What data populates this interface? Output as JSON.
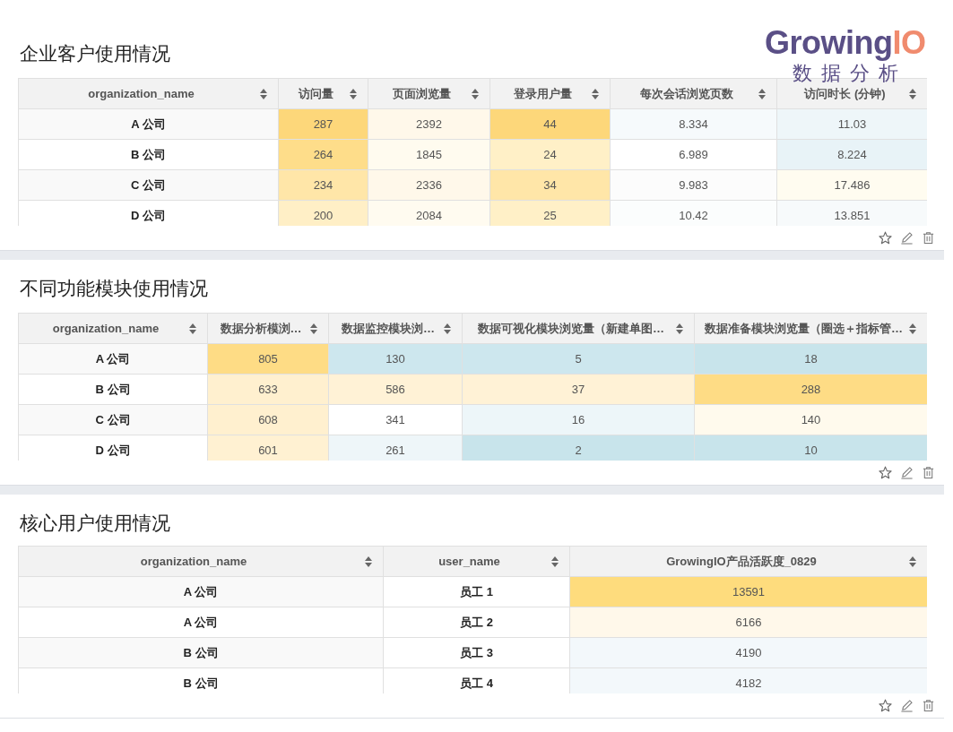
{
  "logo": {
    "word_1": "Growing",
    "word_2": "IO",
    "tagline": "数据分析"
  },
  "sections": [
    {
      "title": "企业客户使用情况",
      "columns": [
        "organization_name",
        "访问量",
        "页面浏览量",
        "登录用户量",
        "每次会话浏览页数",
        "访问时长 (分钟)"
      ],
      "rows": [
        {
          "cells": [
            {
              "value": "A 公司"
            },
            {
              "value": "287",
              "color": "#fdd77a"
            },
            {
              "value": "2392",
              "color": "#fff8ea"
            },
            {
              "value": "44",
              "color": "#fdd77a"
            },
            {
              "value": "8.334",
              "color": "#f6fafc"
            },
            {
              "value": "11.03",
              "color": "#eef6f9"
            }
          ]
        },
        {
          "cells": [
            {
              "value": "B 公司"
            },
            {
              "value": "264",
              "color": "#fedd8a"
            },
            {
              "value": "1845",
              "color": "#fffbef"
            },
            {
              "value": "24",
              "color": "#fff0c7"
            },
            {
              "value": "6.989",
              "color": "#ffffff"
            },
            {
              "value": "8.224",
              "color": "#e8f3f7"
            }
          ]
        },
        {
          "cells": [
            {
              "value": "C 公司"
            },
            {
              "value": "234",
              "color": "#ffe6a8"
            },
            {
              "value": "2336",
              "color": "#fff8ea"
            },
            {
              "value": "34",
              "color": "#ffe6a8"
            },
            {
              "value": "9.983",
              "color": "#fcfcfc"
            },
            {
              "value": "17.486",
              "color": "#fffcf0"
            }
          ]
        },
        {
          "cells": [
            {
              "value": "D 公司"
            },
            {
              "value": "200",
              "color": "#ffefc6"
            },
            {
              "value": "2084",
              "color": "#fffbf0"
            },
            {
              "value": "25",
              "color": "#fff0c7"
            },
            {
              "value": "10.42",
              "color": "#fbfdfd"
            },
            {
              "value": "13.851",
              "color": "#f7fafb"
            }
          ]
        }
      ]
    },
    {
      "title": "不同功能模块使用情况",
      "columns": [
        "organization_name",
        "数据分析模浏…",
        "数据监控模块浏…",
        "数据可视化模块浏览量（新建单图…",
        "数据准备模块浏览量（圈选＋指标管…"
      ],
      "rows": [
        {
          "cells": [
            {
              "value": "A 公司"
            },
            {
              "value": "805",
              "color": "#fedc85"
            },
            {
              "value": "130",
              "color": "#cde7ee"
            },
            {
              "value": "5",
              "color": "#cde7ee"
            },
            {
              "value": "18",
              "color": "#c8e4eb"
            }
          ]
        },
        {
          "cells": [
            {
              "value": "B 公司"
            },
            {
              "value": "633",
              "color": "#fff0cf"
            },
            {
              "value": "586",
              "color": "#fff2d6"
            },
            {
              "value": "37",
              "color": "#fff2d6"
            },
            {
              "value": "288",
              "color": "#fedc85"
            }
          ]
        },
        {
          "cells": [
            {
              "value": "C 公司"
            },
            {
              "value": "608",
              "color": "#fff0cf"
            },
            {
              "value": "341",
              "color": "#ffffff"
            },
            {
              "value": "16",
              "color": "#edf6f9"
            },
            {
              "value": "140",
              "color": "#fffaed"
            }
          ]
        },
        {
          "cells": [
            {
              "value": "D 公司"
            },
            {
              "value": "601",
              "color": "#fff1d2"
            },
            {
              "value": "261",
              "color": "#eef6f9"
            },
            {
              "value": "2",
              "color": "#c8e4eb"
            },
            {
              "value": "10",
              "color": "#c8e4eb"
            }
          ]
        }
      ]
    },
    {
      "title": "核心用户使用情况",
      "columns": [
        "organization_name",
        "user_name",
        "GrowingIO产品活跃度_0829"
      ],
      "rows": [
        {
          "cells": [
            {
              "value": "A 公司"
            },
            {
              "value": "员工 1"
            },
            {
              "value": "13591",
              "color": "#fedc7d"
            }
          ]
        },
        {
          "cells": [
            {
              "value": "A 公司"
            },
            {
              "value": "员工 2"
            },
            {
              "value": "6166",
              "color": "#fff8ea"
            }
          ]
        },
        {
          "cells": [
            {
              "value": "B 公司"
            },
            {
              "value": "员工 3"
            },
            {
              "value": "4190",
              "color": "#f3f8fb"
            }
          ]
        },
        {
          "cells": [
            {
              "value": "B 公司"
            },
            {
              "value": "员工 4"
            },
            {
              "value": "4182",
              "color": "#f3f8fb"
            }
          ]
        }
      ]
    }
  ]
}
